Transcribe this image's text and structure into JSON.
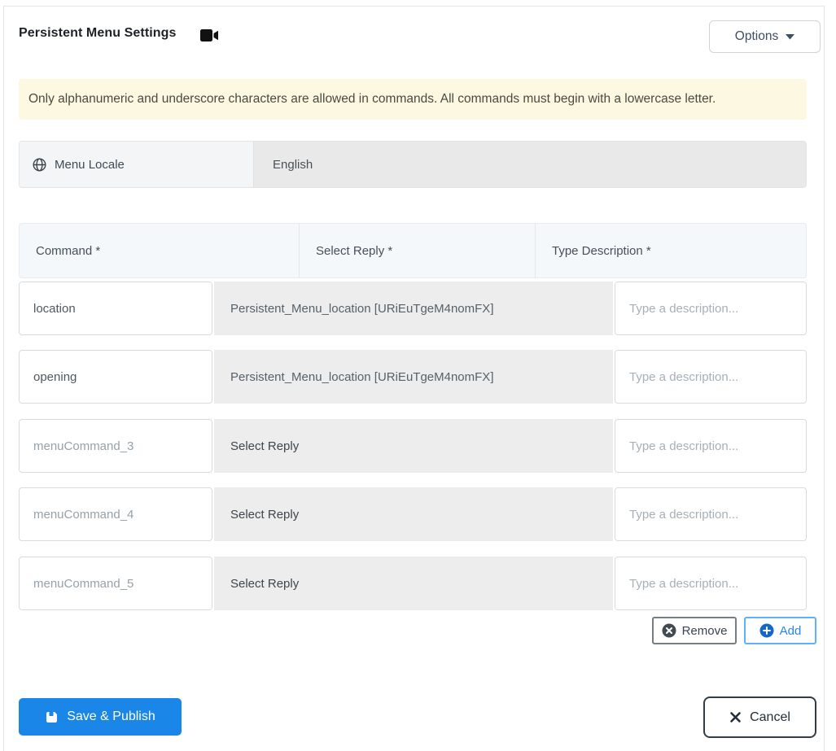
{
  "header": {
    "title": "Persistent Menu Settings",
    "options_button": "Options"
  },
  "alert": {
    "text": "Only alphanumeric and underscore characters are allowed in commands. All commands must begin with a lowercase letter."
  },
  "locale": {
    "label": "Menu Locale",
    "value": "English"
  },
  "table": {
    "columns": [
      "Command *",
      "Select Reply *",
      "Type Description *"
    ],
    "rows": [
      {
        "command": "location",
        "command_filled": true,
        "reply": "Persistent_Menu_location [URiEuTgeM4nomFX]",
        "reply_filled": true,
        "description_placeholder": "Type a description..."
      },
      {
        "command": "opening",
        "command_filled": true,
        "reply": "Persistent_Menu_location [URiEuTgeM4nomFX]",
        "reply_filled": true,
        "description_placeholder": "Type a description..."
      },
      {
        "command": "menuCommand_3",
        "command_filled": false,
        "reply": "Select Reply",
        "reply_filled": false,
        "description_placeholder": "Type a description..."
      },
      {
        "command": "menuCommand_4",
        "command_filled": false,
        "reply": "Select Reply",
        "reply_filled": false,
        "description_placeholder": "Type a description..."
      },
      {
        "command": "menuCommand_5",
        "command_filled": false,
        "reply": "Select Reply",
        "reply_filled": false,
        "description_placeholder": "Type a description..."
      }
    ]
  },
  "table_actions": {
    "remove": "Remove",
    "add": "Add"
  },
  "footer": {
    "save": "Save & Publish",
    "cancel": "Cancel"
  },
  "colors": {
    "primary_blue": "#1a87e8",
    "add_blue": "#2187e9",
    "alert_bg": "#fcf8e2",
    "select_bg": "#ededed",
    "header_bg": "#f5f8fa",
    "locale_label_bg": "#f3f5f6",
    "locale_value_bg": "#e9e9e9"
  }
}
